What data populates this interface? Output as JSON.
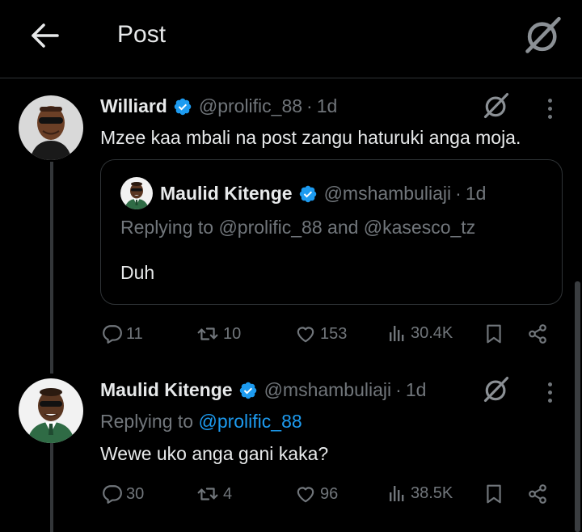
{
  "header": {
    "title": "Post",
    "back_icon": "arrow-left-icon",
    "grok_icon": "grok-icon"
  },
  "tweets": [
    {
      "name": "Williard",
      "handle": "@prolific_88",
      "sep": "·",
      "time": "1d",
      "text": "Mzee kaa mbali na post zangu haturuki anga moja.",
      "quote": {
        "name": "Maulid Kitenge",
        "handle": "@mshambuliaji",
        "sep": "·",
        "time": "1d",
        "reply": "Replying to @prolific_88 and @kasesco_tz",
        "text": "Duh"
      },
      "actions": {
        "replies": "11",
        "reposts": "10",
        "likes": "153",
        "views": "30.4K"
      }
    },
    {
      "name": "Maulid Kitenge",
      "handle": "@mshambuliaji",
      "sep": "·",
      "time": "1d",
      "reply_prefix": "Replying to",
      "reply_to": "@prolific_88",
      "text": "Wewe uko anga gani kaka?",
      "actions": {
        "replies": "30",
        "reposts": "4",
        "likes": "96",
        "views": "38.5K"
      }
    }
  ],
  "colors": {
    "background": "#000000",
    "text": "#e7e9ea",
    "muted": "#71767b",
    "accent": "#1d9bf0",
    "border": "#2f3336"
  }
}
